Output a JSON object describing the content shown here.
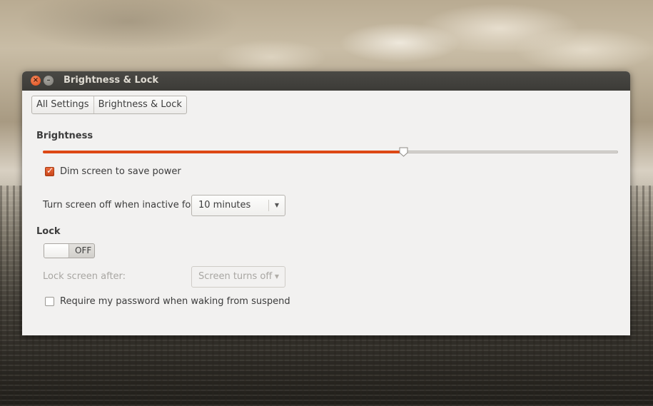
{
  "window": {
    "title": "Brightness & Lock"
  },
  "breadcrumb": {
    "items": [
      {
        "label": "All Settings"
      },
      {
        "label": "Brightness & Lock"
      }
    ]
  },
  "brightness": {
    "heading": "Brightness",
    "level": 0.626,
    "accent_color": "#dd4814",
    "dim_screen": {
      "label": "Dim screen to save power",
      "checked": true
    },
    "screen_off": {
      "label": "Turn screen off when inactive for:",
      "selected": "10 minutes"
    }
  },
  "lock": {
    "heading": "Lock",
    "toggle": {
      "state": "OFF"
    },
    "lock_after": {
      "label": "Lock screen after:",
      "selected": "Screen turns off",
      "enabled": false
    },
    "require_password": {
      "label": "Require my password when waking from suspend",
      "checked": false
    }
  },
  "icons": {
    "close": "close-icon",
    "minimize": "minimize-icon",
    "dropdown": "chevron-down-icon",
    "check": "check-icon"
  }
}
